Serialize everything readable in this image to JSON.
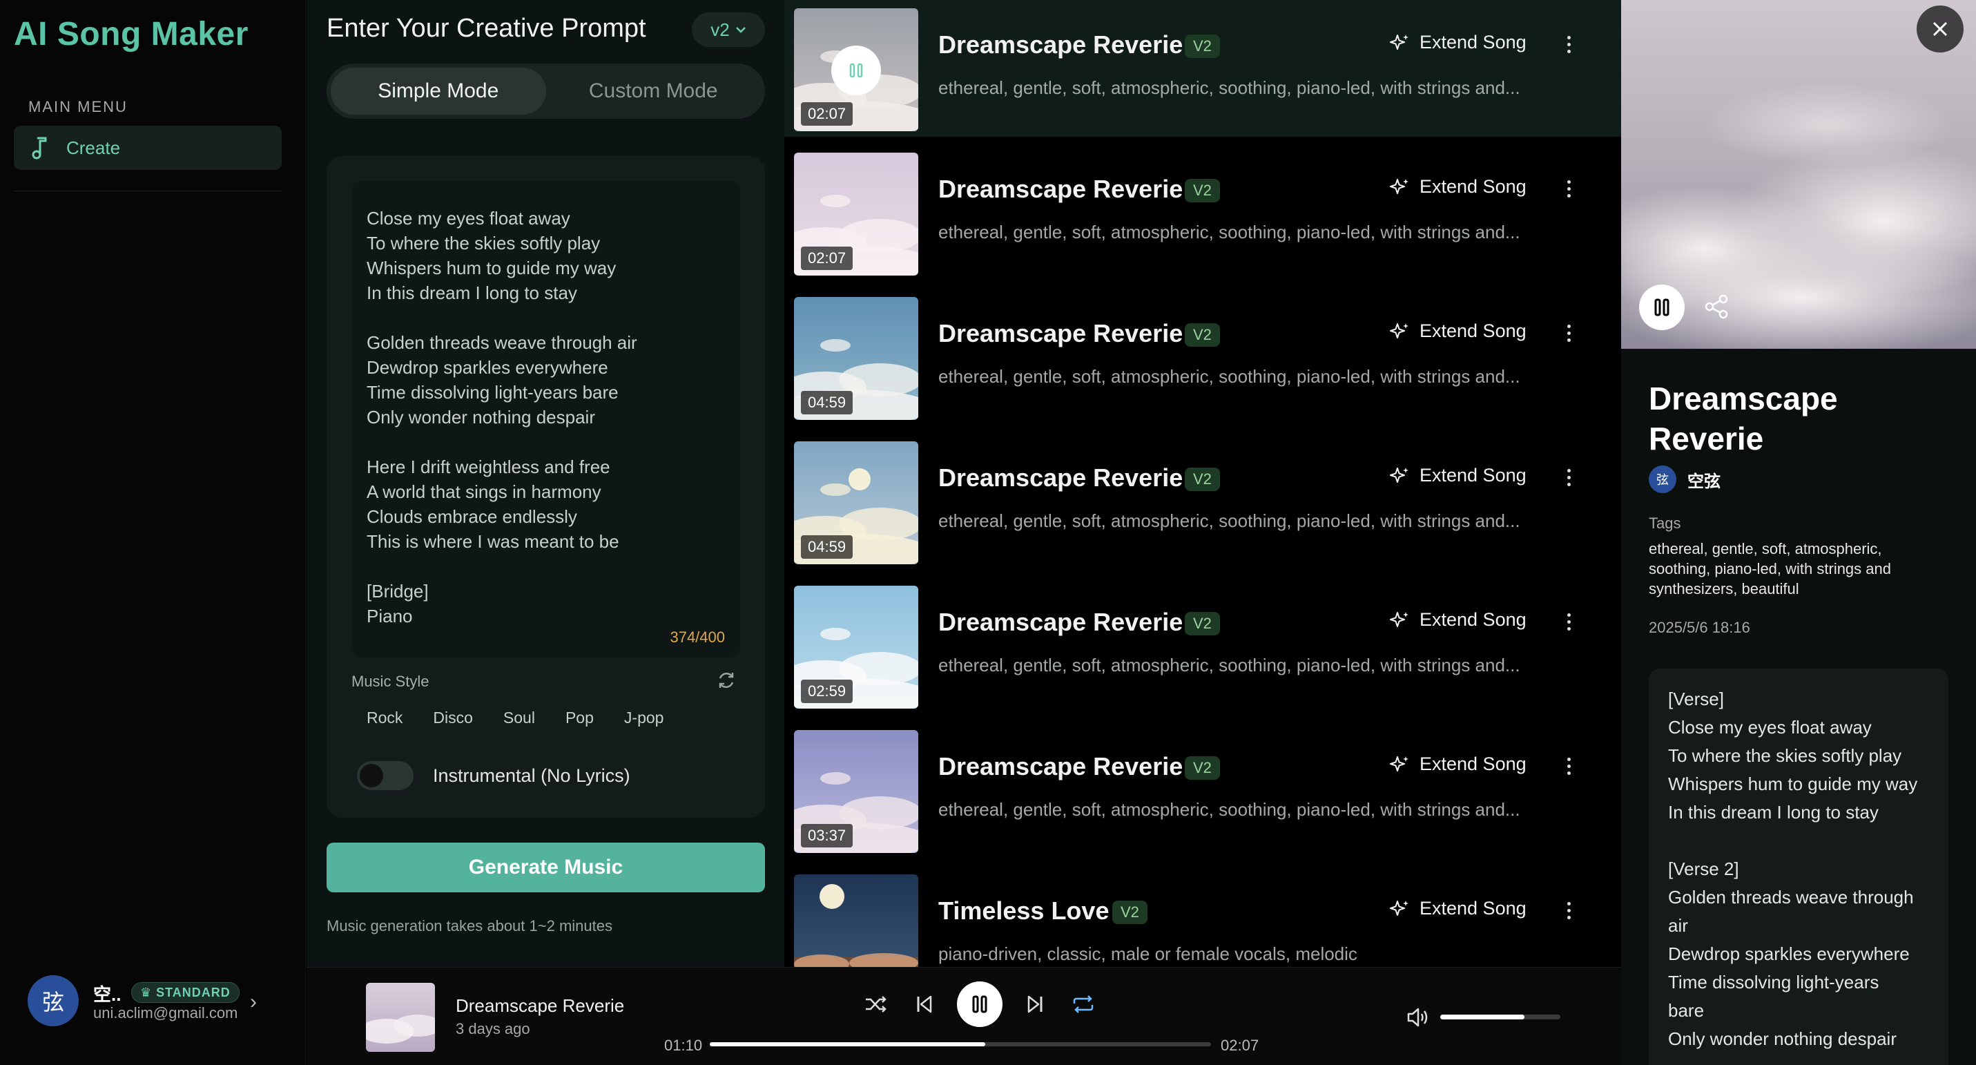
{
  "app": {
    "title": "AI Song Maker"
  },
  "sidebar": {
    "menu_heading": "MAIN MENU",
    "items": [
      {
        "label": "Create",
        "icon": "music-note-icon",
        "active": true
      }
    ],
    "user": {
      "avatar_char": "弦",
      "name": "空..",
      "plan": "STANDARD",
      "email": "uni.aclim@gmail.com"
    }
  },
  "prompt": {
    "title": "Enter Your Creative Prompt",
    "version": "v2",
    "modes": [
      "Simple Mode",
      "Custom Mode"
    ],
    "active_mode": "Simple Mode",
    "lyrics": [
      "Close my eyes float away",
      "To where the skies softly play",
      "Whispers hum to guide my way",
      "In this dream I long to stay",
      "",
      "Golden threads weave through air",
      "Dewdrop sparkles everywhere",
      "Time dissolving light-years bare",
      "Only wonder nothing despair",
      "",
      "Here I drift weightless and free",
      "A world that sings in harmony",
      "Clouds embrace endlessly",
      "This is where I was meant to be",
      "",
      "[Bridge]",
      "Piano"
    ],
    "char_count": "374/400",
    "music_style_label": "Music Style",
    "styles": [
      "Rock",
      "Disco",
      "Soul",
      "Pop",
      "J-pop"
    ],
    "instrumental_label": "Instrumental (No Lyrics)",
    "instrumental_on": false,
    "generate_label": "Generate Music",
    "generate_note": "Music generation takes about 1~2 minutes"
  },
  "songs": [
    {
      "title": "Dreamscape Reverie",
      "version": "V2",
      "duration": "02:07",
      "tags": "ethereal, gentle, soft, atmospheric, soothing, piano-led, with strings and...",
      "active": true,
      "theme": "sunset-clouds"
    },
    {
      "title": "Dreamscape Reverie",
      "version": "V2",
      "duration": "02:07",
      "tags": "ethereal, gentle, soft, atmospheric, soothing, piano-led, with strings and...",
      "active": false,
      "theme": "pink-clouds"
    },
    {
      "title": "Dreamscape Reverie",
      "version": "V2",
      "duration": "04:59",
      "tags": "ethereal, gentle, soft, atmospheric, soothing, piano-led, with strings and...",
      "active": false,
      "theme": "blue-sky"
    },
    {
      "title": "Dreamscape Reverie",
      "version": "V2",
      "duration": "04:59",
      "tags": "ethereal, gentle, soft, atmospheric, soothing, piano-led, with strings and...",
      "active": false,
      "theme": "sun-sky"
    },
    {
      "title": "Dreamscape Reverie",
      "version": "V2",
      "duration": "02:59",
      "tags": "ethereal, gentle, soft, atmospheric, soothing, piano-led, with strings and...",
      "active": false,
      "theme": "light-blue"
    },
    {
      "title": "Dreamscape Reverie",
      "version": "V2",
      "duration": "03:37",
      "tags": "ethereal, gentle, soft, atmospheric, soothing, piano-led, with strings and...",
      "active": false,
      "theme": "lavender"
    },
    {
      "title": "Timeless Love",
      "version": "V2",
      "duration": "",
      "tags": "piano-driven, classic, male or female vocals, melodic",
      "active": false,
      "theme": "moon-night"
    }
  ],
  "song_actions": {
    "extend_label": "Extend Song"
  },
  "detail": {
    "title": "Dreamscape Reverie",
    "author_avatar_char": "弦",
    "author": "空弦",
    "tags_label": "Tags",
    "tags": "ethereal, gentle, soft, atmospheric, soothing, piano-led, with strings and synthesizers, beautiful",
    "date": "2025/5/6 18:16",
    "lyrics": [
      "[Verse]",
      "Close my eyes float away",
      "To where the skies softly play",
      "Whispers hum to guide my way",
      "In this dream I long to stay",
      "",
      "[Verse 2]",
      "Golden threads weave through",
      "air",
      "Dewdrop sparkles everywhere",
      "Time dissolving light-years",
      "bare",
      "Only wonder nothing despair"
    ]
  },
  "player": {
    "title": "Dreamscape Reverie",
    "subtitle": "3 days ago",
    "current_time": "01:10",
    "total_time": "02:07",
    "progress": 0.55,
    "volume": 0.7
  },
  "colors": {
    "accent": "#5bc3a6",
    "generate_button": "#54b39c",
    "version_badge_bg": "#1d3a24",
    "char_count": "#e0a84a"
  }
}
